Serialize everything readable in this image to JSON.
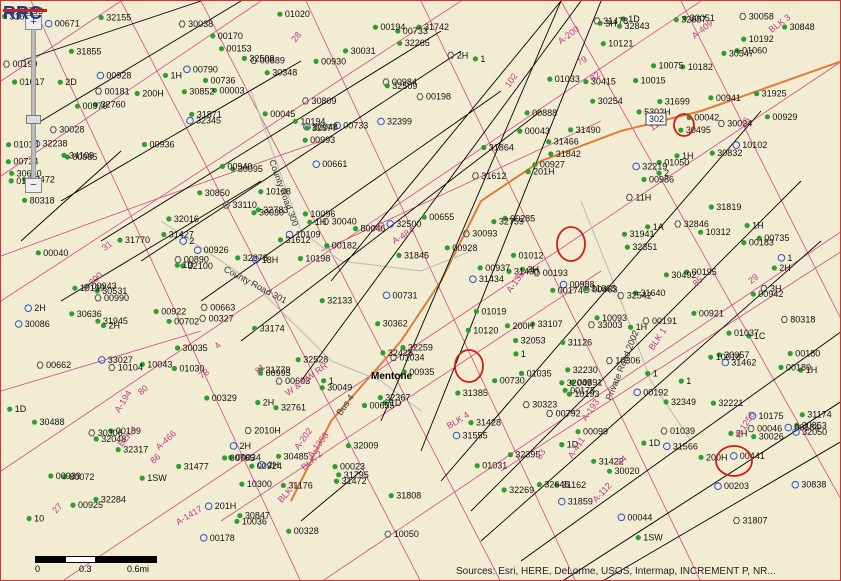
{
  "map": {
    "town": "Mentone",
    "roads": [
      "County Road 300",
      "County Road 302",
      "County Road 300",
      "County Road 301",
      "Private Road 2002",
      "Bus 4"
    ],
    "highway_shields": [
      "302",
      "302"
    ],
    "surveys": [
      "W & NW RR",
      "BLK 2",
      "BLK 2",
      "BLK 1",
      "BLK 4",
      "BLK 1",
      "BLK 3",
      "A-1417",
      "A-390",
      "A-202",
      "A-200",
      "A-466",
      "A-1256",
      "A-409",
      "A-194",
      "A-484",
      "A-135",
      "A-193",
      "A-1358",
      "A-112",
      "A-411",
      "86",
      "85",
      "84",
      "83",
      "82",
      "81",
      "80",
      "79",
      "78",
      "77",
      "26",
      "27",
      "31",
      "28",
      "29",
      "30",
      "102",
      "11",
      "4"
    ],
    "labels": [
      "201H",
      "1H",
      "1SW",
      "32349",
      "5302H",
      "32345",
      "200H",
      "32367",
      "33110",
      "10312",
      "31699",
      "32783",
      "1",
      "2",
      "2",
      "1",
      "1",
      "1",
      "1H",
      "00735",
      "00736",
      "00734",
      "00733",
      "00731",
      "00730",
      "00928",
      "00927",
      "00929",
      "01037",
      "1",
      "1",
      "1SW",
      "00922",
      "00921",
      "00925",
      "00926",
      "00924",
      "1A",
      "01036",
      "01039",
      "01031",
      "01018",
      "01035",
      "01034",
      "01033",
      "01030",
      "00995",
      "00993",
      "00990",
      "00988",
      "00986",
      "00984",
      "01020",
      "00930",
      "00928",
      "00891",
      "00890",
      "00889",
      "00328",
      "00327",
      "00329",
      "01050",
      "31665",
      "31842",
      "32843",
      "31845",
      "31126",
      "31612",
      "31612",
      "1C",
      "30832",
      "30040",
      "30848",
      "30809",
      "30847",
      "30853",
      "32645",
      "1H",
      "2H",
      "3H",
      "2H",
      "3H",
      "1H",
      "2H",
      "2H",
      "32049",
      "31566",
      "30852",
      "30850",
      "32265",
      "32269",
      "32238",
      "32259",
      "32048",
      "32053",
      "31945",
      "31941",
      "32050",
      "31871",
      "1H",
      "00180",
      "00174",
      "00175",
      "00170",
      "00195",
      "00199",
      "00191",
      "00192",
      "00180",
      "00189",
      "00193",
      "00194",
      "00181",
      "00182",
      "00183",
      "00184",
      "80048",
      "00671",
      "00023",
      "00003",
      "01019",
      "00985",
      "00970",
      "00034",
      "31808",
      "32230",
      "01017",
      "1D",
      "1D",
      "1D",
      "30030",
      "30031",
      "30547",
      "30026",
      "30028",
      "11H",
      "32508",
      "3H",
      "32428",
      "2H",
      "30020",
      "32509",
      "18H",
      "32500",
      "2H",
      "32009",
      "31807",
      "2H",
      "32378",
      "1H",
      "32317",
      "1D",
      "30034",
      "32377",
      "32016",
      "1D",
      "31859",
      "2H",
      "31864",
      "10",
      "1D",
      "10093",
      "31925",
      "10096",
      "10198",
      "31640",
      "32657",
      "80318",
      "2D",
      "80318",
      "31795",
      "32351",
      "2010H",
      "33174",
      "31490",
      "32472",
      "30495",
      "31555",
      "32395",
      "10075",
      "10015",
      "31472",
      "31477",
      "31462",
      "31478",
      "31174",
      "200H",
      "31176",
      "31490",
      "200H",
      "80046",
      "201H",
      "30348",
      "30492",
      "30640",
      "30838",
      "10043",
      "10050",
      "30058",
      "33027",
      "10018",
      "10036",
      "10193",
      "00603",
      "00285",
      "00203",
      "00198",
      "01012",
      "10104",
      "10102",
      "10121",
      "10120",
      "10199",
      "10194",
      "10192",
      "10182",
      "10175",
      "10108",
      "10109",
      "32284",
      "32221",
      "32542",
      "31819",
      "31855",
      "32219",
      "32528",
      "33003",
      "30035",
      "30038",
      "00099",
      "00441",
      "00463",
      "00792",
      "00793",
      "00733",
      "00790",
      "00765",
      "00655",
      "30049",
      "32100",
      "00935",
      "00936",
      "00937",
      "00940",
      "00941",
      "00942",
      "00943",
      "01060",
      "00939",
      "31779",
      "31428",
      "31162",
      "30362",
      "31434",
      "30415",
      "30485",
      "31385",
      "30323",
      "31742",
      "32155",
      "32399",
      "31654",
      "30636",
      "31422",
      "31466",
      "30254",
      "30306",
      "00153",
      "10300",
      "31427",
      "32846",
      "32133",
      "31770",
      "00662",
      "00663",
      "00661",
      "00702",
      "00888",
      "00042",
      "00040",
      "00046",
      "00045",
      "00044",
      "00043",
      "00655",
      "30086",
      "30093",
      "30095",
      "30488",
      "10306",
      "32759",
      "32760",
      "30531",
      "32761",
      "33107",
      "34109",
      "80072",
      "30051",
      "30057",
      "00178"
    ],
    "attribution": "Sources: Esri, HERE, DeLorme, USGS, Intermap, INCREMENT P, NR...",
    "scale": {
      "ticks": [
        "0",
        "0.3",
        "0.6mi"
      ]
    },
    "logo": "RRC",
    "zoom": {
      "in": "+",
      "out": "−"
    }
  },
  "colors": {
    "background": "#f2ecd2",
    "survey": "#d04a8a",
    "oil_well": "#2f9e2f",
    "location": "#2b52c8",
    "highlight": "#d21b1b",
    "road": "#e07b3a"
  }
}
